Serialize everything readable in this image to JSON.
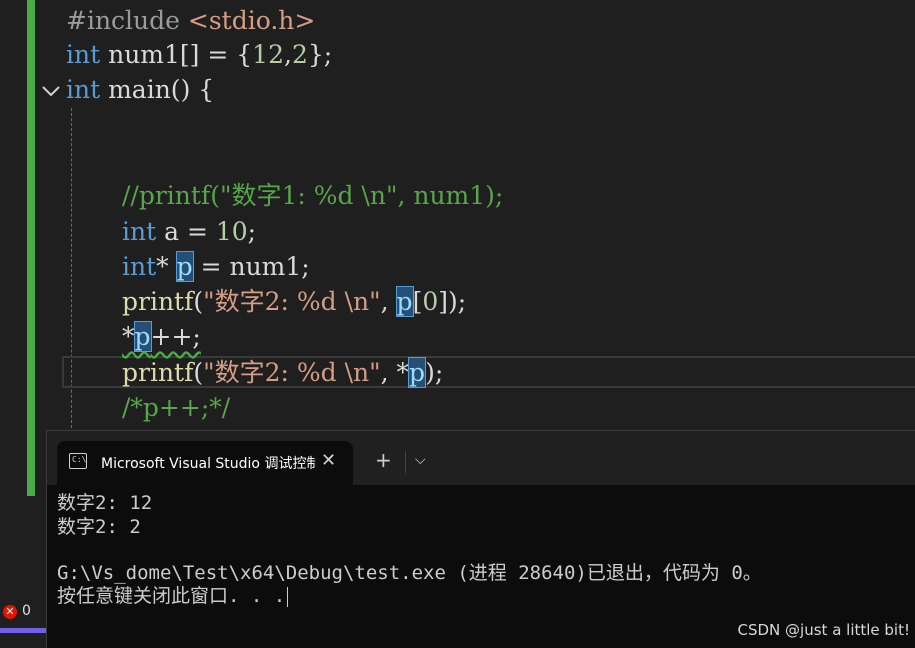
{
  "editor": {
    "lines": {
      "l1": [
        "#include ",
        "<stdio.h>"
      ],
      "l2": [
        "int",
        " num1[] = {",
        "12",
        ",",
        "2",
        "};"
      ],
      "l3": [
        "int",
        " main() {"
      ],
      "l4": "//printf(\"数字1: %d \\n\", num1);",
      "l5": [
        "int",
        " a = ",
        "10",
        ";"
      ],
      "l6": [
        "int",
        "* ",
        "p",
        " = num1;"
      ],
      "l7": [
        "printf",
        "(",
        "\"数字2: %d \\n\"",
        ", ",
        "p",
        "[",
        "0",
        "]);"
      ],
      "l8": [
        "*",
        "p",
        "++;"
      ],
      "l9": [
        "printf",
        "(",
        "\"数字2: %d \\n\"",
        ", *",
        "p",
        ");"
      ],
      "l10": "/*p++;*/"
    }
  },
  "status": {
    "error_icon": "error-circle-icon",
    "error_count": "0"
  },
  "terminal": {
    "tab_title": "Microsoft Visual Studio 调试控制台",
    "tab_icon_text": "C:\\",
    "close_glyph": "✕",
    "new_tab_glyph": "+",
    "dropdown_glyph": "⌵",
    "output": [
      "数字2: 12",
      "数字2: 2",
      "",
      "G:\\Vs_dome\\Test\\x64\\Debug\\test.exe (进程 28640)已退出，代码为 0。",
      "按任意键关闭此窗口. . ."
    ],
    "watermark": "CSDN @just a little bit!"
  },
  "colors": {
    "keyword": "#569cd6",
    "string": "#d69d85",
    "comment": "#57a64a",
    "number": "#b5cea8",
    "change_bar": "#4aaa45",
    "error": "#e51400"
  }
}
